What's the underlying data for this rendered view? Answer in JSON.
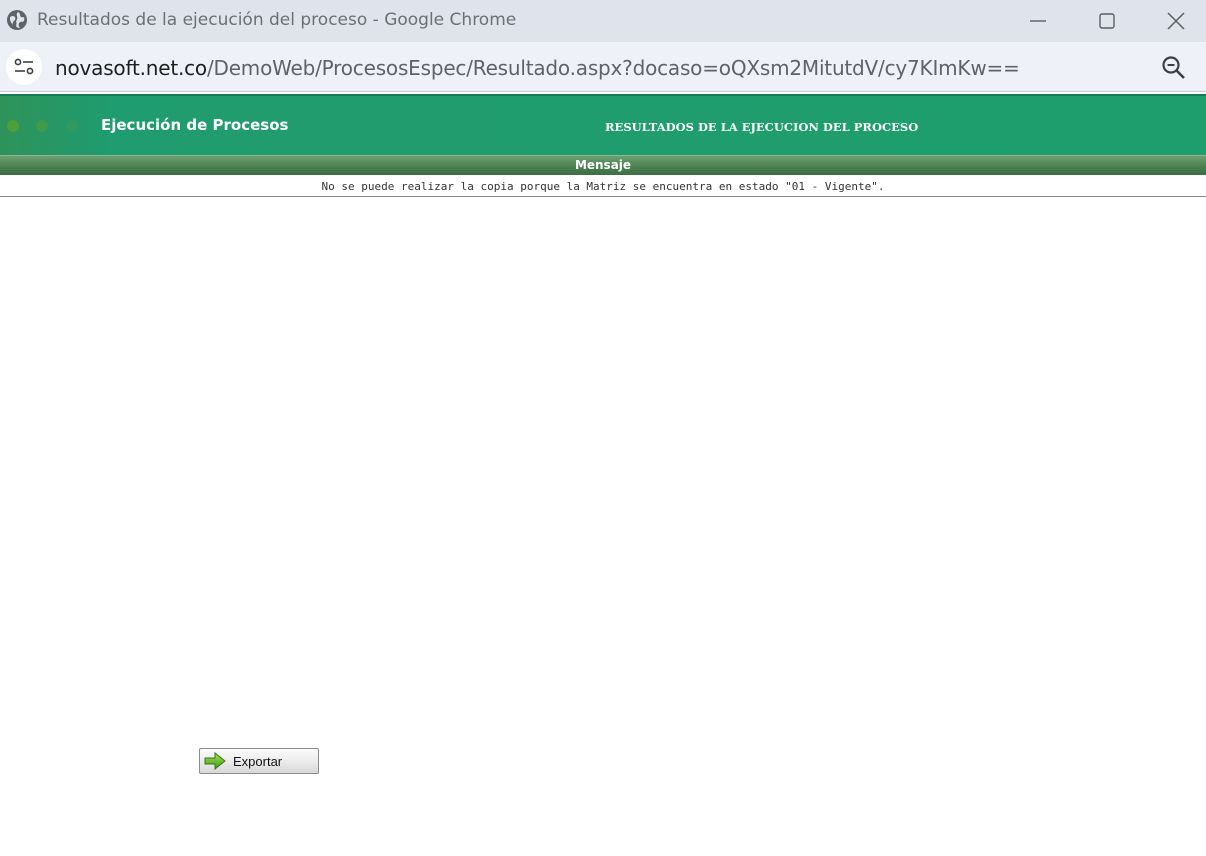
{
  "window": {
    "title": "Resultados de la ejecución del proceso - Google Chrome",
    "controls": {
      "minimize": "minimize-icon",
      "maximize": "maximize-icon",
      "close": "close-icon"
    }
  },
  "addressbar": {
    "url_host": "novasoft.net.co",
    "url_path": "/DemoWeb/ProcesosEspec/Resultado.aspx?docaso=oQXsm2MitutdV/cy7KImKw==",
    "site_info_icon": "site-settings-icon",
    "zoom_icon": "zoom-out-icon"
  },
  "header": {
    "app_title": "Ejecución de Procesos",
    "page_heading": "RESULTADOS DE LA EJECUCION DEL PROCESO"
  },
  "message": {
    "title": "Mensaje",
    "text": "No se puede realizar la copia porque la Matriz se encuentra en estado \"01 - Vigente\"."
  },
  "actions": {
    "export_label": "Exportar",
    "export_icon": "arrow-right-icon"
  },
  "colors": {
    "header_green": "#1e9b70",
    "message_bar_green": "#4b7f52"
  }
}
